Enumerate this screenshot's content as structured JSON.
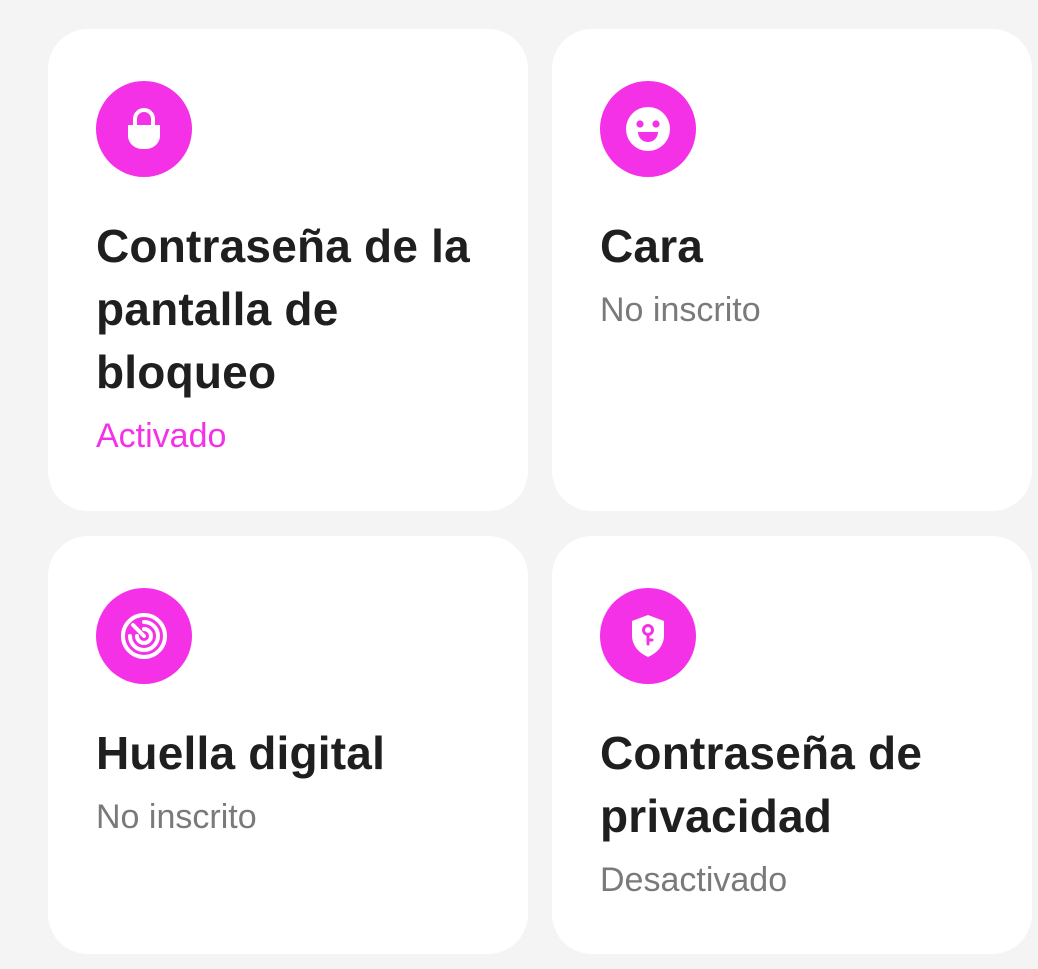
{
  "accent_color": "#f531e8",
  "cards": [
    {
      "icon": "lock-icon",
      "title": "Contraseña de la pantalla de bloqueo",
      "status": "Activado",
      "active": true
    },
    {
      "icon": "face-icon",
      "title": "Cara",
      "status": "No inscrito",
      "active": false
    },
    {
      "icon": "fingerprint-icon",
      "title": "Huella digital",
      "status": "No inscrito",
      "active": false
    },
    {
      "icon": "shield-key-icon",
      "title": "Contraseña de privacidad",
      "status": "Desactivado",
      "active": false
    }
  ]
}
